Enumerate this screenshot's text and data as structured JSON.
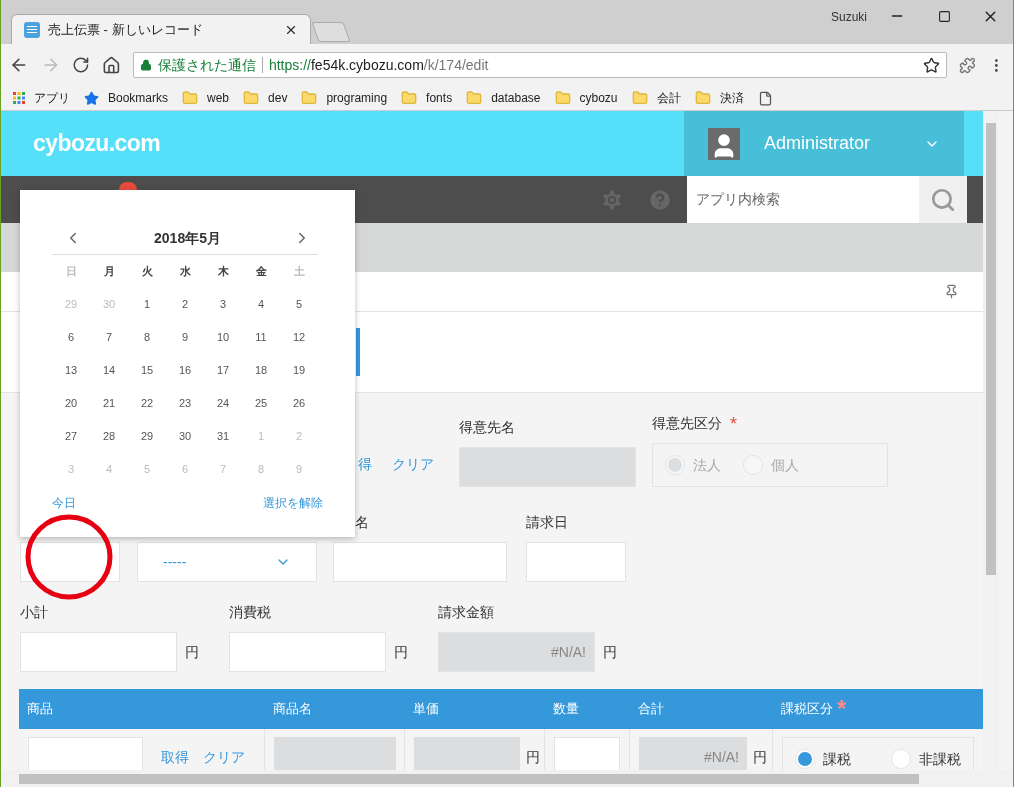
{
  "browser": {
    "tab_title": "売上伝票 - 新しいレコード",
    "profile": "Suzuki",
    "security_label": "保護された通信",
    "url_scheme": "https://",
    "url_host": "fe54k.cybozu.com",
    "url_path": "/k/174/edit"
  },
  "bookmarks": [
    {
      "kind": "apps",
      "label": "アプリ"
    },
    {
      "kind": "star",
      "label": "Bookmarks"
    },
    {
      "kind": "folder",
      "label": "web"
    },
    {
      "kind": "folder",
      "label": "dev"
    },
    {
      "kind": "folder",
      "label": "programing"
    },
    {
      "kind": "folder",
      "label": "fonts"
    },
    {
      "kind": "folder",
      "label": "database"
    },
    {
      "kind": "folder",
      "label": "cybozu"
    },
    {
      "kind": "folder",
      "label": "会計"
    },
    {
      "kind": "folder",
      "label": "決済"
    },
    {
      "kind": "page"
    }
  ],
  "header": {
    "logo": "cybozu.com",
    "user": "Administrator"
  },
  "search": {
    "placeholder": "アプリ内検索"
  },
  "calendar": {
    "title": "2018年5月",
    "weekdays": [
      {
        "label": "日",
        "muted": true
      },
      {
        "label": "月",
        "muted": false
      },
      {
        "label": "火",
        "muted": false
      },
      {
        "label": "水",
        "muted": false
      },
      {
        "label": "木",
        "muted": false
      },
      {
        "label": "金",
        "muted": false
      },
      {
        "label": "土",
        "muted": true
      }
    ],
    "weeks": [
      [
        {
          "day": "29",
          "in_month": false
        },
        {
          "day": "30",
          "in_month": false
        },
        {
          "day": "1",
          "in_month": true
        },
        {
          "day": "2",
          "in_month": true
        },
        {
          "day": "3",
          "in_month": true
        },
        {
          "day": "4",
          "in_month": true
        },
        {
          "day": "5",
          "in_month": true
        }
      ],
      [
        {
          "day": "6",
          "in_month": true
        },
        {
          "day": "7",
          "in_month": true
        },
        {
          "day": "8",
          "in_month": true
        },
        {
          "day": "9",
          "in_month": true
        },
        {
          "day": "10",
          "in_month": true
        },
        {
          "day": "11",
          "in_month": true
        },
        {
          "day": "12",
          "in_month": true
        }
      ],
      [
        {
          "day": "13",
          "in_month": true
        },
        {
          "day": "14",
          "in_month": true
        },
        {
          "day": "15",
          "in_month": true
        },
        {
          "day": "16",
          "in_month": true
        },
        {
          "day": "17",
          "in_month": true
        },
        {
          "day": "18",
          "in_month": true
        },
        {
          "day": "19",
          "in_month": true
        }
      ],
      [
        {
          "day": "20",
          "in_month": true
        },
        {
          "day": "21",
          "in_month": true
        },
        {
          "day": "22",
          "in_month": true
        },
        {
          "day": "23",
          "in_month": true
        },
        {
          "day": "24",
          "in_month": true
        },
        {
          "day": "25",
          "in_month": true
        },
        {
          "day": "26",
          "in_month": true
        }
      ],
      [
        {
          "day": "27",
          "in_month": true
        },
        {
          "day": "28",
          "in_month": true
        },
        {
          "day": "29",
          "in_month": true
        },
        {
          "day": "30",
          "in_month": true
        },
        {
          "day": "31",
          "in_month": true
        },
        {
          "day": "1",
          "in_month": false
        },
        {
          "day": "2",
          "in_month": false
        }
      ],
      [
        {
          "day": "3",
          "in_month": false
        },
        {
          "day": "4",
          "in_month": false
        },
        {
          "day": "5",
          "in_month": false
        },
        {
          "day": "6",
          "in_month": false
        },
        {
          "day": "7",
          "in_month": false
        },
        {
          "day": "8",
          "in_month": false
        },
        {
          "day": "9",
          "in_month": false
        }
      ]
    ],
    "today_label": "今日",
    "clear_label": "選択を解除"
  },
  "form": {
    "lookup_links": [
      "得",
      "クリア"
    ],
    "customer_name": {
      "label": "得意先名",
      "disabled": true
    },
    "customer_type": {
      "label": "得意先区分",
      "required_mark": "*",
      "disabled": true,
      "options": [
        {
          "label": "法人",
          "selected": true
        },
        {
          "label": "個人",
          "selected": false
        }
      ]
    },
    "dropdown": {
      "value": "-----"
    },
    "subject_label": "名",
    "billing_date": {
      "label": "請求日"
    },
    "amounts": [
      {
        "label": "小計",
        "unit": "円",
        "disabled": false
      },
      {
        "label": "消費税",
        "unit": "円",
        "disabled": false
      },
      {
        "label": "請求金額",
        "unit": "円",
        "disabled": true,
        "value": "#N/A!"
      }
    ]
  },
  "table": {
    "columns": [
      {
        "label": "商品"
      },
      {
        "label": "商品名"
      },
      {
        "label": "単価"
      },
      {
        "label": "数量"
      },
      {
        "label": "合計"
      },
      {
        "label": "課税区分",
        "required_mark": "*"
      }
    ],
    "row": {
      "links": [
        "取得",
        "クリア"
      ],
      "price_unit": "円",
      "total": "#N/A!",
      "total_unit": "円",
      "tax_options": [
        {
          "label": "課税",
          "selected": true
        },
        {
          "label": "非課税",
          "selected": false
        }
      ]
    }
  }
}
